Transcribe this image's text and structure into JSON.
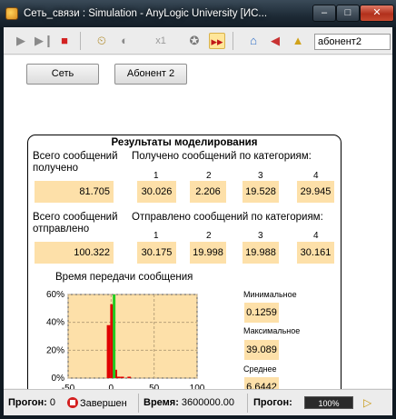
{
  "window": {
    "title": "Сеть_связи : Simulation - AnyLogic University  [ИС...",
    "minimize": "–",
    "maximize": "□",
    "close": "✕"
  },
  "toolbar": {
    "speed": "x1",
    "search_value": "абонент2"
  },
  "buttons": {
    "network": "Сеть",
    "subscriber": "Абонент 2"
  },
  "panel": {
    "title": "Результаты моделирования",
    "received_total_label": "Всего сообщений\nполучено",
    "received_by_cat_label": "Получено сообщений по категориям:",
    "received_total_value": "81.705",
    "sent_total_label": "Всего сообщений\nотправлено",
    "sent_by_cat_label": "Отправлено сообщений по категориям:",
    "sent_total_value": "100.322",
    "categories": [
      "1",
      "2",
      "3",
      "4"
    ],
    "received_values": [
      "30.026",
      "2.206",
      "19.528",
      "29.945"
    ],
    "sent_values": [
      "30.175",
      "19.998",
      "19.988",
      "30.161"
    ],
    "histogram_title": "Время передачи сообщения",
    "min_label": "Минимальное",
    "min_value": "0.1259",
    "max_label": "Максимальное",
    "max_value": "39.089",
    "avg_label": "Среднее",
    "avg_value": "6.6442"
  },
  "chart_data": {
    "type": "bar",
    "title": "Время передачи сообщения",
    "xlim": [
      -50,
      100
    ],
    "ylim": [
      0,
      60
    ],
    "x_ticks": [
      "-50",
      "0",
      "50",
      "100"
    ],
    "y_ticks": [
      "0%",
      "20%",
      "40%",
      "60%"
    ],
    "grid": true,
    "bin_width": 4,
    "bins": [
      {
        "x": -3,
        "value": 38
      },
      {
        "x": 1,
        "value": 53
      },
      {
        "x": 5,
        "value": 6
      },
      {
        "x": 9,
        "value": 1
      },
      {
        "x": 13,
        "value": 1
      },
      {
        "x": 21,
        "value": 1
      }
    ],
    "mean_marker": 6.6442,
    "colors": {
      "background": "#fde0a9",
      "bars": "#e00000",
      "mean": "#22cc22",
      "grid": "#b9a27a"
    }
  },
  "status": {
    "run_label": "Прогон:",
    "run_value": "0",
    "state": "Завершен",
    "time_label": "Время:",
    "time_value": "3600000.00",
    "run2_label": "Прогон:",
    "progress": "100%"
  }
}
